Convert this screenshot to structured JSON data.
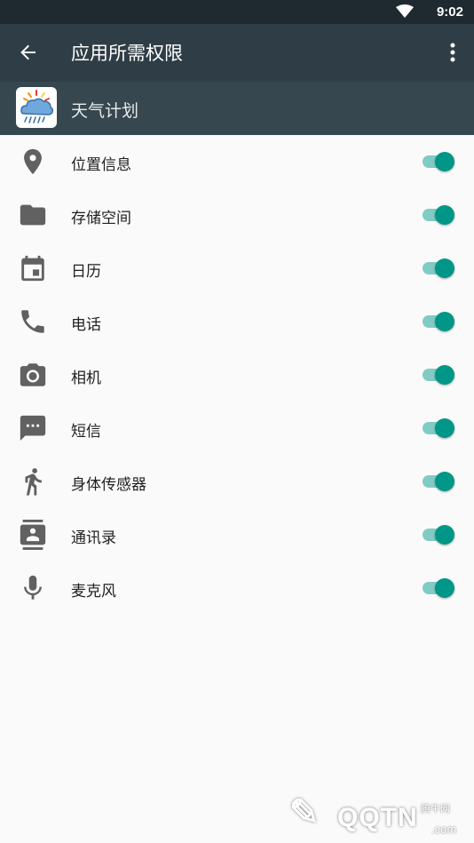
{
  "status_bar": {
    "time": "9:02",
    "wifi_icon": "wifi-icon"
  },
  "app_bar": {
    "title": "应用所需权限",
    "back_icon": "arrow-back-icon",
    "more_icon": "more-vertical-icon"
  },
  "app": {
    "name": "天气计划",
    "icon": "weather-app-icon"
  },
  "permissions": [
    {
      "label": "位置信息",
      "icon": "location-icon",
      "enabled": true
    },
    {
      "label": "存储空间",
      "icon": "folder-icon",
      "enabled": true
    },
    {
      "label": "日历",
      "icon": "calendar-icon",
      "enabled": true
    },
    {
      "label": "电话",
      "icon": "phone-icon",
      "enabled": true
    },
    {
      "label": "相机",
      "icon": "camera-icon",
      "enabled": true
    },
    {
      "label": "短信",
      "icon": "sms-icon",
      "enabled": true
    },
    {
      "label": "身体传感器",
      "icon": "body-sensor-icon",
      "enabled": true
    },
    {
      "label": "通讯录",
      "icon": "contacts-icon",
      "enabled": true
    },
    {
      "label": "麦克风",
      "icon": "microphone-icon",
      "enabled": true
    }
  ],
  "colors": {
    "status_bar": "#1f2a30",
    "app_bar": "#2f3e46",
    "app_header": "#37474f",
    "toggle_thumb": "#009688",
    "toggle_track": "#80cbc4",
    "icon_gray": "#616161"
  },
  "watermark": {
    "logo_text": "QQTN",
    "site_label": "腾牛网",
    "domain_suffix": ".com"
  }
}
